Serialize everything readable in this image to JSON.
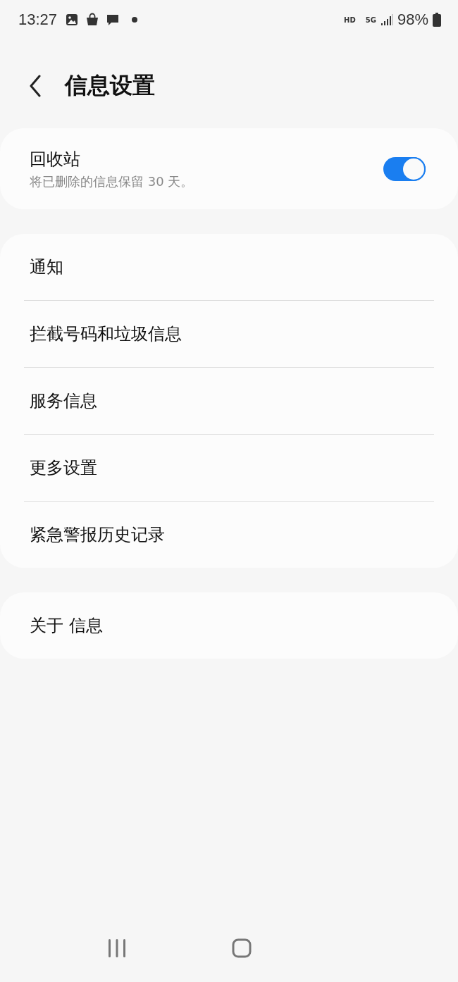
{
  "status_bar": {
    "time": "13:27",
    "network_badge": "HD",
    "network_type": "5G",
    "battery": "98%"
  },
  "header": {
    "title": "信息设置"
  },
  "recycle_bin": {
    "title": "回收站",
    "subtitle": "将已删除的信息保留 30 天。",
    "on": true
  },
  "menu_items": [
    {
      "label": "通知"
    },
    {
      "label": "拦截号码和垃圾信息"
    },
    {
      "label": "服务信息"
    },
    {
      "label": "更多设置"
    },
    {
      "label": "紧急警报历史记录"
    }
  ],
  "about": {
    "label": "关于 信息"
  }
}
